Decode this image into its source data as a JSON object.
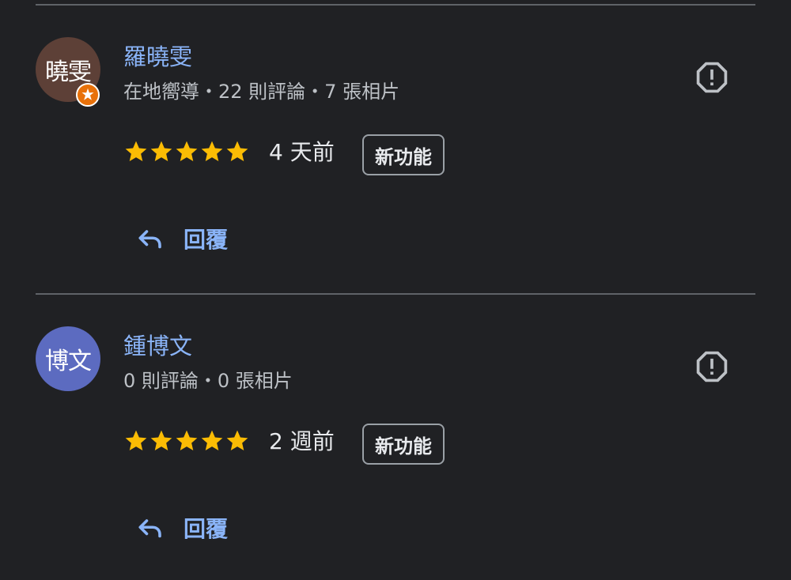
{
  "reviews": [
    {
      "avatar_text": "曉雯",
      "avatar_color": "#5d4037",
      "has_local_guide_badge": true,
      "author": "羅曉雯",
      "meta": "在地嚮導・22 則評論・7 張相片",
      "rating": 5,
      "time": "4 天前",
      "badge": "新功能",
      "reply_label": "回覆"
    },
    {
      "avatar_text": "博文",
      "avatar_color": "#5c6bc0",
      "has_local_guide_badge": false,
      "author": "鍾博文",
      "meta": "0 則評論・0 張相片",
      "rating": 5,
      "time": "2 週前",
      "badge": "新功能",
      "reply_label": "回覆"
    }
  ],
  "icons": {
    "report": "report-flag-icon",
    "star": "star-icon",
    "reply": "reply-arrow-icon",
    "local_guide": "local-guide-star-icon"
  },
  "colors": {
    "background": "#202124",
    "link": "#8ab4f8",
    "star": "#fbbc04",
    "divider": "#5f6368"
  }
}
